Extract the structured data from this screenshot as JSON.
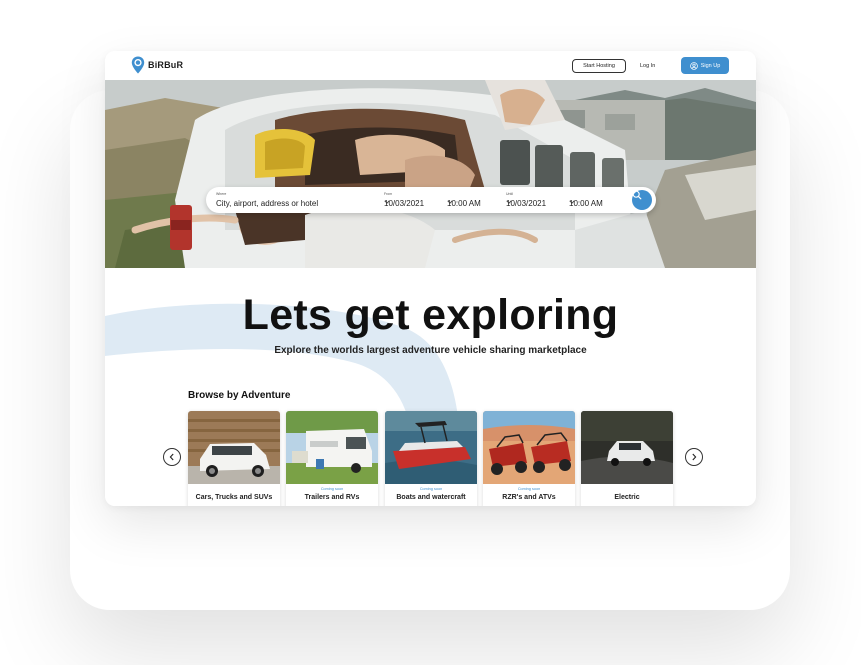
{
  "brand": {
    "name": "BiRBuR",
    "accent": "#3f8fcf"
  },
  "header": {
    "start_hosting": "Start Hosting",
    "login": "Log In",
    "signup": "Sign Up"
  },
  "search": {
    "where_label": "Where",
    "where_value": "City, airport, address or hotel",
    "from_label": "From",
    "from_date": "10/03/2021",
    "from_time": "10:00 AM",
    "until_label": "Until",
    "until_date": "10/03/2021",
    "until_time": "10:00 AM",
    "icons": {
      "chevron": "chevron-down-icon",
      "search": "search-icon"
    }
  },
  "main": {
    "headline": "Lets get exploring",
    "subheadline": "Explore the worlds largest adventure vehicle sharing marketplace",
    "browse_title": "Browse by Adventure"
  },
  "categories": [
    {
      "label": "Cars, Trucks and SUVs",
      "badge": ""
    },
    {
      "label": "Trailers and RVs",
      "badge": "Coming soon"
    },
    {
      "label": "Boats and watercraft",
      "badge": "Coming soon"
    },
    {
      "label": "RZR's and ATVs",
      "badge": "Coming soon"
    },
    {
      "label": "Electric",
      "badge": ""
    }
  ]
}
